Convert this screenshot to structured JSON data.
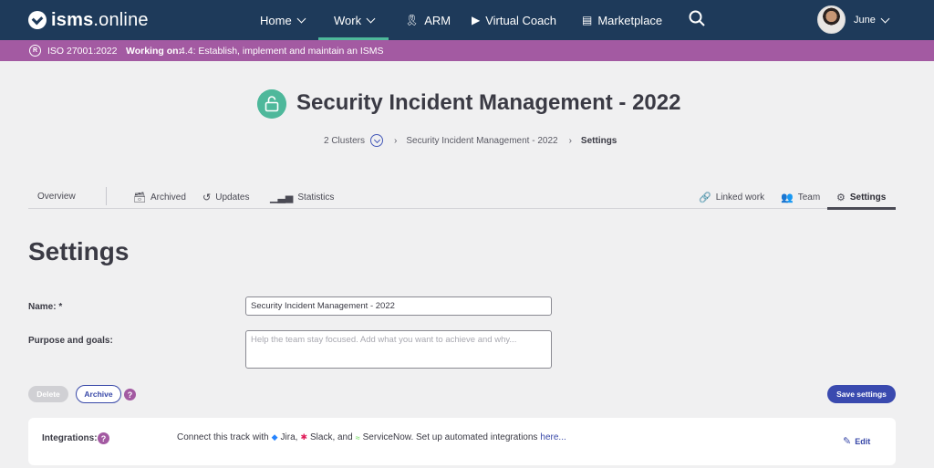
{
  "brand": {
    "logo_bold": "isms",
    "logo_light": ".online"
  },
  "nav": {
    "home": "Home",
    "work": "Work",
    "arm": "ARM",
    "virtual_coach": "Virtual Coach",
    "marketplace": "Marketplace",
    "user": "June"
  },
  "context_bar": {
    "standard": "ISO 27001:2022",
    "working_on_label": "Working on:",
    "working_on_value": "4.4: Establish, implement and maintain an ISMS"
  },
  "header": {
    "title": "Security Incident Management - 2022",
    "breadcrumb": {
      "clusters": "2 Clusters",
      "track": "Security Incident Management - 2022",
      "current": "Settings"
    }
  },
  "tabs": {
    "overview": "Overview",
    "archived": "Archived",
    "updates": "Updates",
    "statistics": "Statistics",
    "linked_work": "Linked work",
    "team": "Team",
    "settings": "Settings"
  },
  "settings": {
    "title": "Settings",
    "name_label": "Name: *",
    "name_value": "Security Incident Management - 2022",
    "goals_label": "Purpose and goals:",
    "goals_placeholder": "Help the team stay focused. Add what you want to achieve and why...",
    "delete_label": "Delete",
    "archive_label": "Archive",
    "save_label": "Save settings",
    "help": "?"
  },
  "integrations": {
    "label": "Integrations:",
    "text_prefix": "Connect this track with",
    "jira": "Jira,",
    "slack": "Slack, and",
    "servicenow": "ServiceNow. Set up automated integrations",
    "link": "here...",
    "edit": "Edit"
  },
  "colors": {
    "nav_bg": "#1e3a5a",
    "context_bar": "#a35aa2",
    "accent_green": "#4eb89b",
    "primary_blue": "#3a4aaf"
  }
}
